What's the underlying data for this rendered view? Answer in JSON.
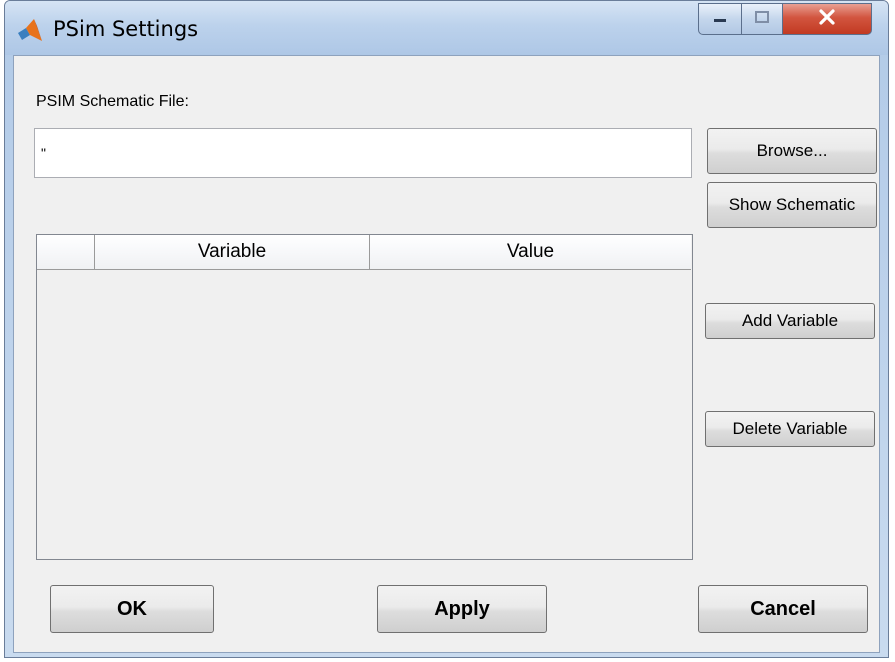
{
  "window": {
    "title": "PSim Settings",
    "icon": "matlab-icon",
    "controls": [
      "minimize-icon",
      "maximize-icon",
      "close-icon"
    ]
  },
  "form": {
    "schematic_label": "PSIM Schematic File:",
    "schematic_value": "\"",
    "browse_label": "Browse...",
    "show_schematic_label": "Show Schematic"
  },
  "table": {
    "columns": [
      "",
      "Variable",
      "Value"
    ],
    "rows": []
  },
  "actions": {
    "add_variable_label": "Add Variable",
    "delete_variable_label": "Delete Variable",
    "ok_label": "OK",
    "apply_label": "Apply",
    "cancel_label": "Cancel"
  },
  "colors": {
    "close_button": "#c8462c",
    "dialog_background": "#f0f0f0",
    "titlebar": "#b9d1ea"
  }
}
